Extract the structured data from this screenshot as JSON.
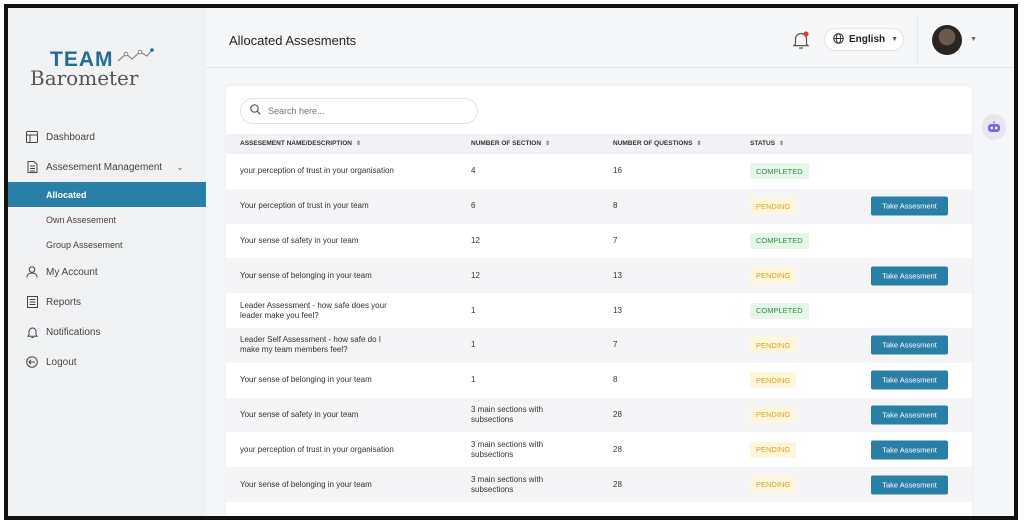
{
  "app": {
    "logo_team": "TEAM",
    "logo_barometer": "Barometer"
  },
  "sidebar": {
    "items": [
      {
        "label": "Dashboard",
        "icon": "dashboard-icon"
      },
      {
        "label": "Assesement Management",
        "icon": "document-icon"
      },
      {
        "label": "My Account",
        "icon": "user-icon"
      },
      {
        "label": "Reports",
        "icon": "reports-icon"
      },
      {
        "label": "Notifications",
        "icon": "bell-icon"
      },
      {
        "label": "Logout",
        "icon": "logout-icon"
      }
    ],
    "sub_items": [
      {
        "label": "Allocated",
        "active": true
      },
      {
        "label": "Own Assesement",
        "active": false
      },
      {
        "label": "Group Assesement",
        "active": false
      }
    ]
  },
  "header": {
    "title": "Allocated Assesments",
    "language": "English"
  },
  "search": {
    "placeholder": "Search here..."
  },
  "table": {
    "columns": [
      "ASSESEMENT NAME/DESCRIPTION",
      "NUMBER OF SECTION",
      "NUMBER OF QUESTIONS",
      "STATUS"
    ],
    "action_label": "Take Assesment",
    "rows": [
      {
        "name": "your perception of trust in your organisation",
        "sections": "4",
        "questions": "16",
        "status": "COMPLETED"
      },
      {
        "name": "Your perception of trust in your team",
        "sections": "6",
        "questions": "8",
        "status": "PENDING"
      },
      {
        "name": "Your sense of safety in your team",
        "sections": "12",
        "questions": "7",
        "status": "COMPLETED"
      },
      {
        "name": "Your sense of belonging in your team",
        "sections": "12",
        "questions": "13",
        "status": "PENDING"
      },
      {
        "name": "Leader Assessment - how safe does your leader make you feel?",
        "sections": "1",
        "questions": "13",
        "status": "COMPLETED"
      },
      {
        "name": "Leader Self Assessment - how safe do I make my team members feel?",
        "sections": "1",
        "questions": "7",
        "status": "PENDING"
      },
      {
        "name": "Your sense of belonging in your team",
        "sections": "1",
        "questions": "8",
        "status": "PENDING"
      },
      {
        "name": "Your sense of safety in your team",
        "sections": "3 main sections with subsections",
        "questions": "28",
        "status": "PENDING"
      },
      {
        "name": "your perception of trust in your organisation",
        "sections": "3 main sections with subsections",
        "questions": "28",
        "status": "PENDING"
      },
      {
        "name": "Your sense of belonging in your team",
        "sections": "3 main sections with subsections",
        "questions": "28",
        "status": "PENDING"
      }
    ]
  },
  "colors": {
    "primary": "#2a7fa6",
    "completed_bg": "#e6f7e9",
    "completed_text": "#2f8e43",
    "pending_bg": "#fff6dc",
    "pending_text": "#d5a520"
  }
}
